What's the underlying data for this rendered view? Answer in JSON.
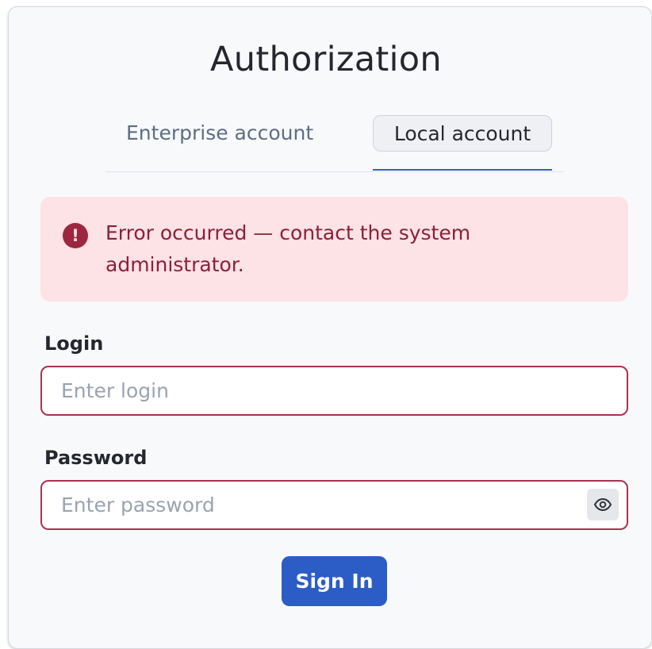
{
  "header": {
    "title": "Authorization"
  },
  "tabs": [
    {
      "label": "Enterprise account",
      "selected": false
    },
    {
      "label": "Local account",
      "selected": true
    }
  ],
  "alert": {
    "icon": "exclamation-circle-icon",
    "message": "Error occurred — contact the system administrator."
  },
  "form": {
    "login": {
      "label": "Login",
      "value": "",
      "placeholder": "Enter login"
    },
    "password": {
      "label": "Password",
      "value": "",
      "placeholder": "Enter password",
      "toggle_icon": "eye-icon"
    },
    "submit_label": "Sign In"
  },
  "colors": {
    "accent": "#2c5cc5",
    "error_text": "#8a2036",
    "error_bg": "#fde2e6",
    "error_border": "#a8334f"
  }
}
